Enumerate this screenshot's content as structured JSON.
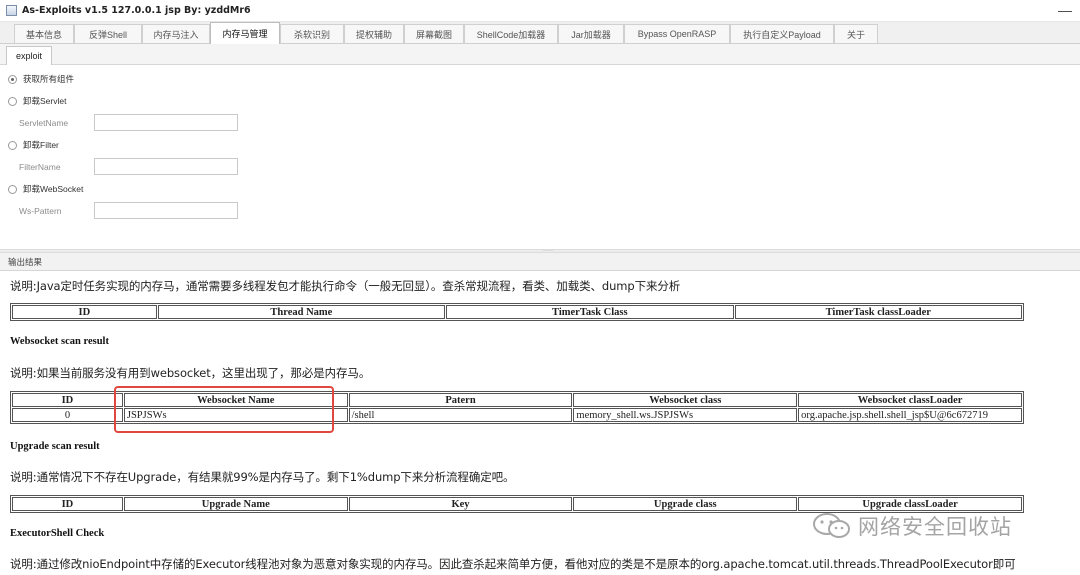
{
  "window": {
    "title": "As-Exploits v1.5 127.0.0.1 jsp By: yzddMr6"
  },
  "tabs": [
    {
      "label": "基本信息",
      "active": false
    },
    {
      "label": "反弹Shell",
      "active": false
    },
    {
      "label": "内存马注入",
      "active": false
    },
    {
      "label": "内存马管理",
      "active": true
    },
    {
      "label": "杀软识别",
      "active": false
    },
    {
      "label": "提权辅助",
      "active": false
    },
    {
      "label": "屏幕截图",
      "active": false
    },
    {
      "label": "ShellCode加载器",
      "active": false
    },
    {
      "label": "Jar加载器",
      "active": false
    },
    {
      "label": "Bypass OpenRASP",
      "active": false
    },
    {
      "label": "执行自定义Payload",
      "active": false
    },
    {
      "label": "关于",
      "active": false
    }
  ],
  "subtab": {
    "label": "exploit"
  },
  "form": {
    "options": [
      {
        "label": "获取所有组件",
        "checked": true
      },
      {
        "label": "卸载Servlet",
        "checked": false
      },
      {
        "label": "卸载Filter",
        "checked": false
      },
      {
        "label": "卸载WebSocket",
        "checked": false
      }
    ],
    "fields": [
      {
        "label": "ServletName",
        "value": ""
      },
      {
        "label": "FilterName",
        "value": ""
      },
      {
        "label": "Ws-Pattern",
        "value": ""
      }
    ]
  },
  "output": {
    "header": "输出结果",
    "timer_note": "说明:Java定时任务实现的内存马，通常需要多线程发包才能执行命令（一般无回显）。查杀常规流程，看类、加载类、dump下来分析",
    "timer_table": {
      "headers": [
        "ID",
        "Thread Name",
        "TimerTask Class",
        "TimerTask classLoader"
      ]
    },
    "ws_title": "Websocket scan result",
    "ws_note": "说明:如果当前服务没有用到websocket，这里出现了，那必是内存马。",
    "ws_table": {
      "headers": [
        "ID",
        "Websocket Name",
        "Patern",
        "Websocket class",
        "Websocket classLoader"
      ],
      "rows": [
        [
          "0",
          "JSPJSWs",
          "/shell",
          "memory_shell.ws.JSPJSWs",
          "org.apache.jsp.shell.shell_jsp$U@6c672719"
        ]
      ]
    },
    "upgrade_title": "Upgrade scan result",
    "upgrade_note": "说明:通常情况下不存在Upgrade，有结果就99%是内存马了。剩下1%dump下来分析流程确定吧。",
    "upgrade_table": {
      "headers": [
        "ID",
        "Upgrade Name",
        "Key",
        "Upgrade class",
        "Upgrade classLoader"
      ]
    },
    "executor_title": "ExecutorShell Check",
    "executor_note": "说明:通过修改nioEndpoint中存储的Executor线程池对象为恶意对象实现的内存马。因此查杀起来简单方便，看他对应的类是不是原本的org.apache.tomcat.util.threads.ThreadPoolExecutor即可"
  },
  "watermark": {
    "text": "网络安全回收站",
    "icon": "wechat-icon"
  },
  "colors": {
    "highlight": "#e0483e"
  }
}
